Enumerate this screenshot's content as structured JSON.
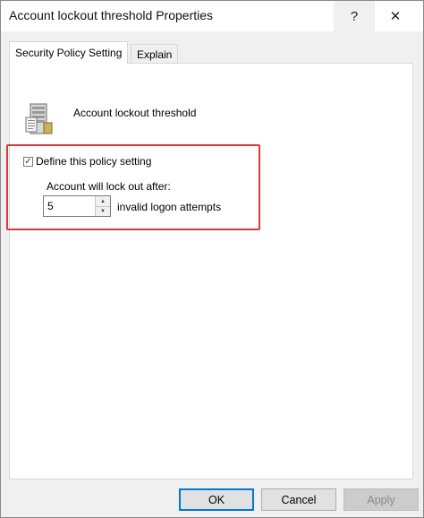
{
  "window": {
    "title": "Account lockout threshold Properties",
    "help_glyph": "?",
    "close_glyph": "✕"
  },
  "tabs": [
    {
      "label": "Security Policy Setting",
      "active": true
    },
    {
      "label": "Explain",
      "active": false
    }
  ],
  "policy": {
    "icon": "server-policy-icon",
    "name": "Account lockout threshold",
    "define_checkbox": {
      "label": "Define this policy setting",
      "checked": true,
      "check_glyph": "✓"
    },
    "lockout_label": "Account will lock out after:",
    "attempts_value": "5",
    "attempts_unit": "invalid logon attempts",
    "highlight_color": "#d93a3f"
  },
  "buttons": {
    "ok": "OK",
    "cancel": "Cancel",
    "apply": "Apply",
    "apply_enabled": false
  }
}
